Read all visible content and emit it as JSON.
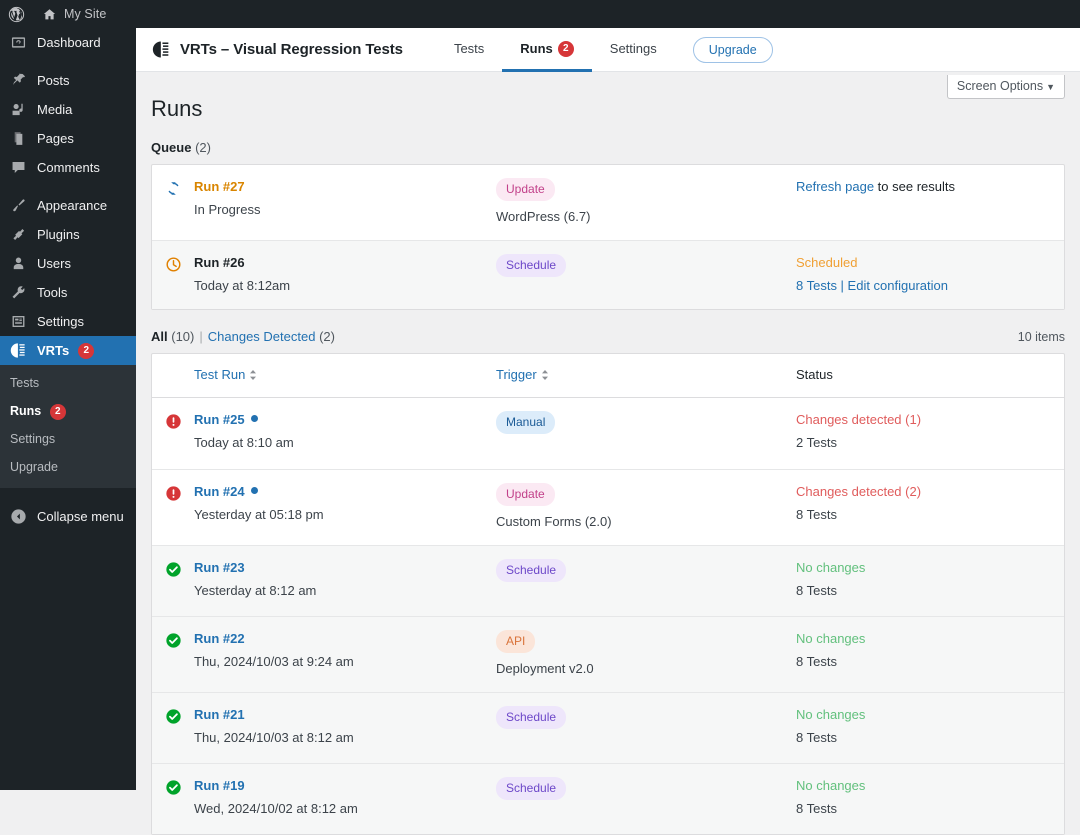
{
  "adminbar": {
    "wp_logo_icon": "wordpress-logo-icon",
    "site_icon": "home-icon",
    "site_label": "My Site"
  },
  "sidebar": {
    "items": [
      {
        "label": "Dashboard",
        "icon": "dashboard-icon",
        "name": "dashboard"
      },
      {
        "label": "Posts",
        "icon": "pin-icon",
        "name": "posts"
      },
      {
        "label": "Media",
        "icon": "media-icon",
        "name": "media"
      },
      {
        "label": "Pages",
        "icon": "pages-icon",
        "name": "pages"
      },
      {
        "label": "Comments",
        "icon": "comments-icon",
        "name": "comments"
      },
      {
        "label": "Appearance",
        "icon": "brush-icon",
        "name": "appearance"
      },
      {
        "label": "Plugins",
        "icon": "plug-icon",
        "name": "plugins"
      },
      {
        "label": "Users",
        "icon": "user-icon",
        "name": "users"
      },
      {
        "label": "Tools",
        "icon": "wrench-icon",
        "name": "tools"
      },
      {
        "label": "Settings",
        "icon": "settings-icon",
        "name": "settings"
      },
      {
        "label": "VRTs",
        "icon": "vrts-icon",
        "name": "vrts",
        "badge": "2",
        "current": true
      }
    ],
    "submenu": [
      {
        "label": "Tests",
        "name": "tests"
      },
      {
        "label": "Runs",
        "name": "runs",
        "badge": "2",
        "current": true
      },
      {
        "label": "Settings",
        "name": "settings"
      },
      {
        "label": "Upgrade",
        "name": "upgrade"
      }
    ],
    "collapse_label": "Collapse menu",
    "collapse_icon": "collapse-arrow-icon",
    "badge_color": "#d63638",
    "current_bg": "#2271b1"
  },
  "plugin_header": {
    "logo_icon": "vrts-logo-icon",
    "title": "VRTs – Visual Regression Tests",
    "tabs": [
      {
        "label": "Tests",
        "name": "tests",
        "active": false
      },
      {
        "label": "Runs",
        "name": "runs",
        "active": true,
        "badge": "2"
      },
      {
        "label": "Settings",
        "name": "settings",
        "active": false
      }
    ],
    "upgrade_label": "Upgrade"
  },
  "screen_options": {
    "label": "Screen Options",
    "caret": "▼"
  },
  "page": {
    "title": "Runs"
  },
  "queue": {
    "label": "Queue",
    "count": "(2)",
    "rows": [
      {
        "icon": "spinner-update-icon",
        "run": "Run #27",
        "run_color": "orange",
        "sub": "In Progress",
        "trigger_pill": "Update",
        "trigger_pill_type": "update",
        "trigger_sub": "WordPress (6.7)",
        "status_link": "Refresh page",
        "status_rest": " to see results",
        "status_sub": "",
        "alt": false
      },
      {
        "icon": "clock-icon",
        "run": "Run #26",
        "run_color": "dark",
        "sub": "Today at 8:12am",
        "trigger_pill": "Schedule",
        "trigger_pill_type": "schedule",
        "trigger_sub": "",
        "status_head": "Scheduled",
        "status_head_color": "orange",
        "status_sub_links": "8 Tests | Edit configuration",
        "alt": true
      }
    ]
  },
  "filterbar": {
    "all_label": "All",
    "all_count": "(10)",
    "separator": "|",
    "changes_label": "Changes Detected",
    "changes_count": "(2)",
    "item_count": "10 items"
  },
  "table": {
    "columns": [
      {
        "label": "Test Run",
        "name": "test-run",
        "sortable": true
      },
      {
        "label": "Trigger",
        "name": "trigger",
        "sortable": true
      },
      {
        "label": "Status",
        "name": "status",
        "sortable": false
      }
    ],
    "rows": [
      {
        "icon": "alert-circle-icon",
        "icon_color": "#d63638",
        "run": "Run #25",
        "unread": true,
        "sub": "Today at 8:10 am",
        "trigger_pill": "Manual",
        "trigger_pill_type": "manual",
        "trigger_sub": "",
        "status_head": "Changes detected (1)",
        "status_head_color": "red",
        "status_sub": "2 Tests",
        "grey": false
      },
      {
        "icon": "alert-circle-icon",
        "icon_color": "#d63638",
        "run": "Run #24",
        "unread": true,
        "sub": "Yesterday at 05:18 pm",
        "trigger_pill": "Update",
        "trigger_pill_type": "update",
        "trigger_sub": "Custom Forms (2.0)",
        "status_head": "Changes detected (2)",
        "status_head_color": "red",
        "status_sub": "8 Tests",
        "grey": false
      },
      {
        "icon": "check-circle-icon",
        "icon_color": "#00a32a",
        "run": "Run #23",
        "unread": false,
        "sub": "Yesterday at 8:12 am",
        "trigger_pill": "Schedule",
        "trigger_pill_type": "schedule",
        "trigger_sub": "",
        "status_head": "No changes",
        "status_head_color": "green",
        "status_sub": "8 Tests",
        "grey": true
      },
      {
        "icon": "check-circle-icon",
        "icon_color": "#00a32a",
        "run": "Run #22",
        "unread": false,
        "sub": "Thu, 2024/10/03 at 9:24 am",
        "trigger_pill": "API",
        "trigger_pill_type": "api",
        "trigger_sub": "Deployment v2.0",
        "status_head": "No changes",
        "status_head_color": "green",
        "status_sub": "8 Tests",
        "grey": true
      },
      {
        "icon": "check-circle-icon",
        "icon_color": "#00a32a",
        "run": "Run #21",
        "unread": false,
        "sub": "Thu, 2024/10/03 at 8:12 am",
        "trigger_pill": "Schedule",
        "trigger_pill_type": "schedule",
        "trigger_sub": "",
        "status_head": "No changes",
        "status_head_color": "green",
        "status_sub": "8 Tests",
        "grey": true
      },
      {
        "icon": "check-circle-icon",
        "icon_color": "#00a32a",
        "run": "Run #19",
        "unread": false,
        "sub": "Wed, 2024/10/02 at 8:12 am",
        "trigger_pill": "Schedule",
        "trigger_pill_type": "schedule",
        "trigger_sub": "",
        "status_head": "No changes",
        "status_head_color": "green",
        "status_sub": "8 Tests",
        "grey": true
      }
    ]
  },
  "colors": {
    "accent": "#2271b1",
    "danger": "#d63638",
    "success": "#00a32a",
    "warning": "#d98500",
    "sidebar_bg": "#1d2327"
  }
}
